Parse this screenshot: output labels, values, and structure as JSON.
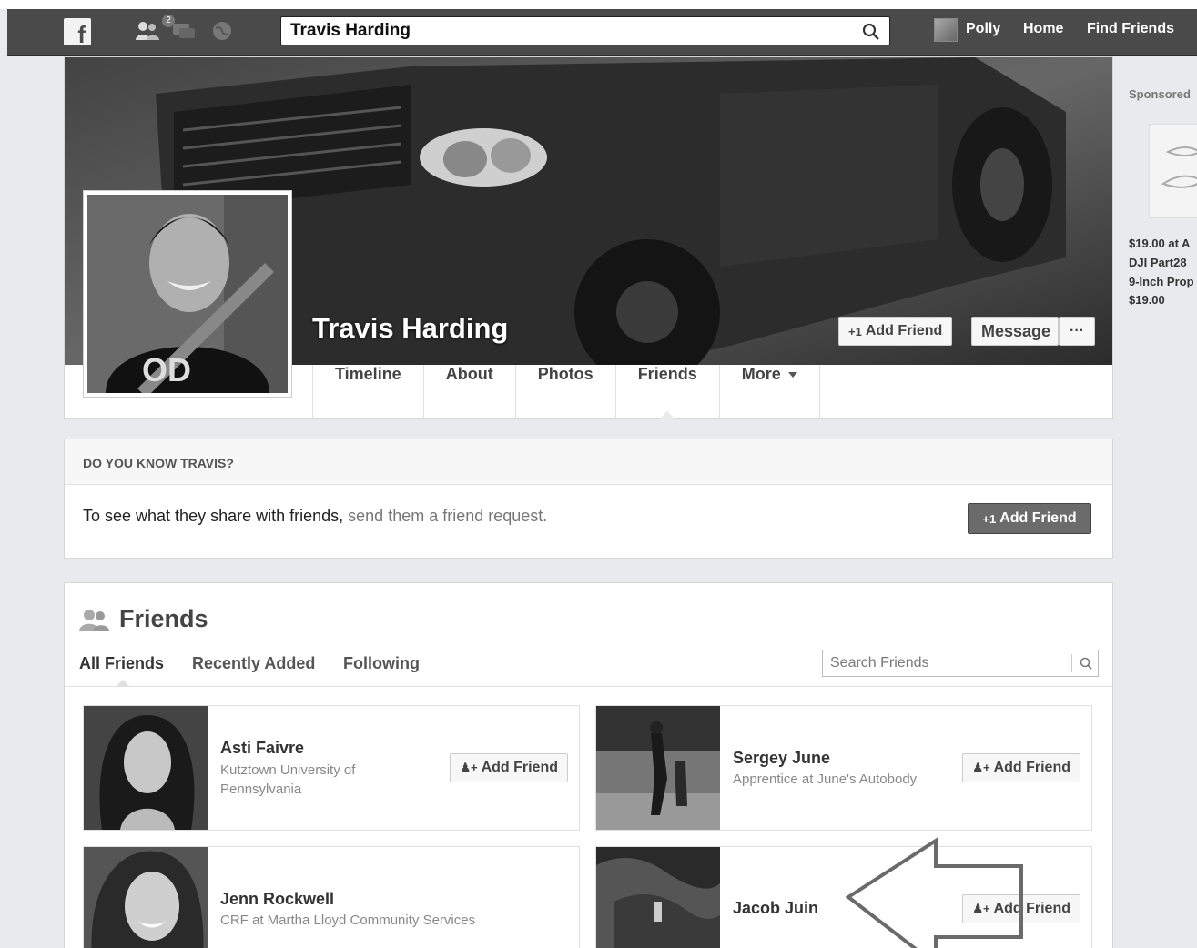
{
  "topbar": {
    "search_value": "Travis Harding",
    "friend_requests_count": "2",
    "user_name": "Polly",
    "home_label": "Home",
    "find_friends_label": "Find Friends"
  },
  "profile": {
    "name": "Travis Harding",
    "add_friend_label": "Add Friend",
    "message_label": "Message",
    "more_dots": "···",
    "tabs": [
      {
        "label": "Timeline"
      },
      {
        "label": "About"
      },
      {
        "label": "Photos"
      },
      {
        "label": "Friends"
      },
      {
        "label": "More"
      }
    ],
    "active_tab": "Friends"
  },
  "know": {
    "heading": "DO YOU KNOW TRAVIS?",
    "text_main": "To see what they share with friends,",
    "text_light": " send them a friend request.",
    "button_label": "Add Friend"
  },
  "friends": {
    "title": "Friends",
    "tabs": [
      "All Friends",
      "Recently Added",
      "Following"
    ],
    "search_placeholder": "Search Friends",
    "list": [
      {
        "name": "Asti Faivre",
        "subtitle": "Kutztown University of Pennsylvania",
        "button": "Add Friend"
      },
      {
        "name": "Sergey June",
        "subtitle": "Apprentice at June's Autobody",
        "button": "Add Friend"
      },
      {
        "name": "Jenn Rockwell",
        "subtitle": "CRF at Martha Lloyd Community Services",
        "button": "Add Friend"
      },
      {
        "name": "Jacob Juin",
        "subtitle": "",
        "button": "Add Friend"
      }
    ]
  },
  "sidebar": {
    "sponsored_label": "Sponsored",
    "ad_lines": [
      "$19.00 at A",
      "DJI Part28",
      "9-Inch Prop",
      "$19.00"
    ]
  },
  "icons": {
    "logo": "facebook-logo-icon",
    "friend_requests": "friend-requests-icon",
    "messages": "messages-icon",
    "notifications": "globe-icon",
    "search": "search-icon",
    "friends_header": "friends-icon",
    "add_friend": "add-friend-icon"
  }
}
